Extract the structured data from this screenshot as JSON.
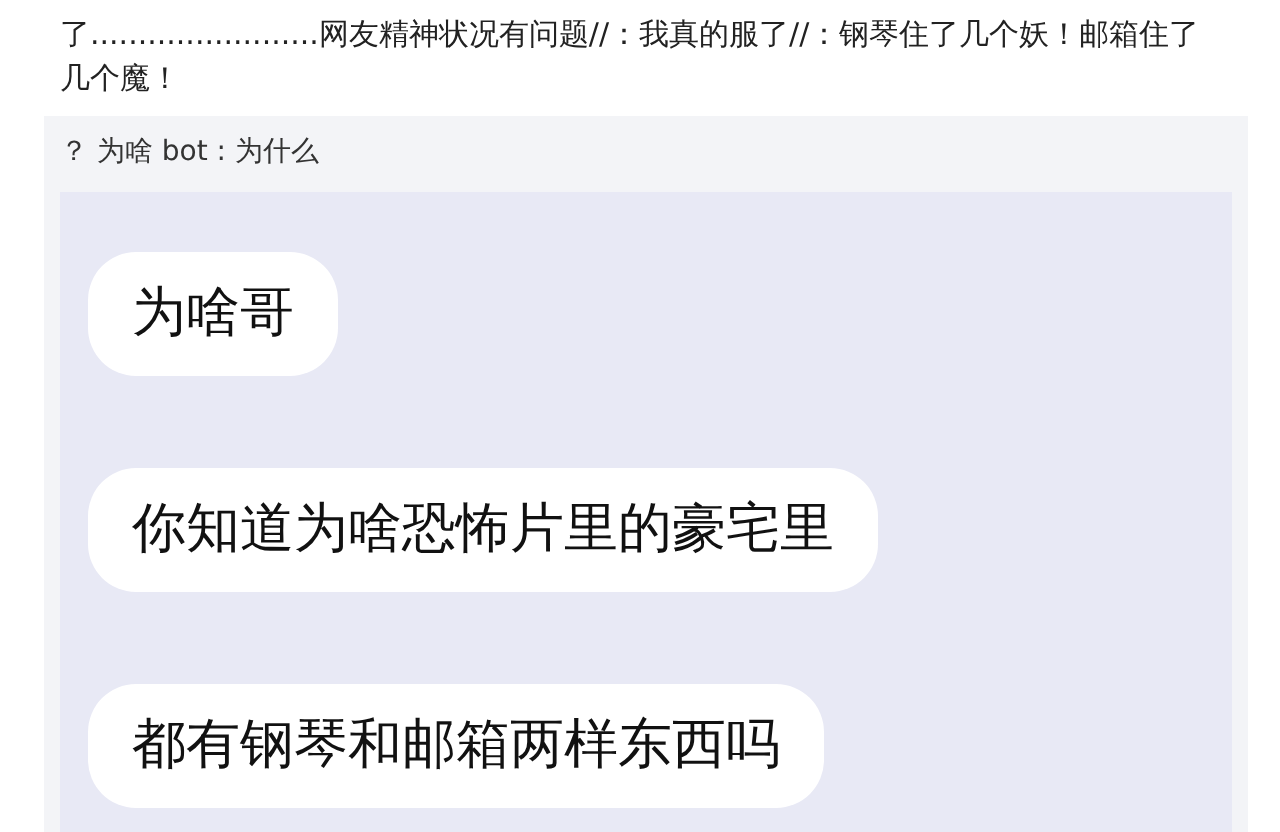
{
  "post": {
    "text": "了........................网友精神状况有问题//：我真的服了//：钢琴住了几个妖！邮箱住了几个魔！"
  },
  "repost": {
    "text": "？ 为啥 bot : 为什么"
  },
  "chat": {
    "messages": [
      {
        "text": "为啥哥"
      },
      {
        "text": "你知道为啥恐怖片里的豪宅里"
      },
      {
        "text": "都有钢琴和邮箱两样东西吗"
      }
    ]
  }
}
